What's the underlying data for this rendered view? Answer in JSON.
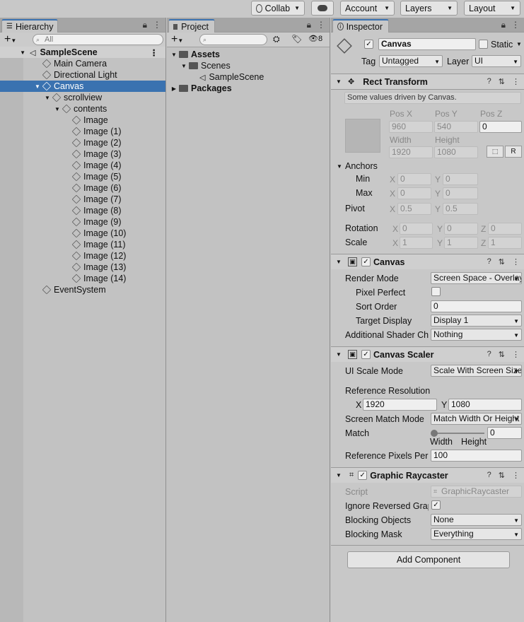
{
  "toolbar": {
    "collab": "Collab",
    "account": "Account",
    "layers": "Layers",
    "layout": "Layout"
  },
  "hierarchy": {
    "tab": "Hierarchy",
    "search_placeholder": "All",
    "scene": "SampleScene",
    "items": [
      {
        "label": "Main Camera",
        "depth": 1
      },
      {
        "label": "Directional Light",
        "depth": 1
      },
      {
        "label": "Canvas",
        "depth": 1,
        "selected": true,
        "expanded": true
      },
      {
        "label": "scrollview",
        "depth": 2,
        "expanded": true
      },
      {
        "label": "contents",
        "depth": 3,
        "expanded": true
      },
      {
        "label": "Image",
        "depth": 4
      },
      {
        "label": "Image (1)",
        "depth": 4
      },
      {
        "label": "Image (2)",
        "depth": 4
      },
      {
        "label": "Image (3)",
        "depth": 4
      },
      {
        "label": "Image (4)",
        "depth": 4
      },
      {
        "label": "Image (5)",
        "depth": 4
      },
      {
        "label": "Image (6)",
        "depth": 4
      },
      {
        "label": "Image (7)",
        "depth": 4
      },
      {
        "label": "Image (8)",
        "depth": 4
      },
      {
        "label": "Image (9)",
        "depth": 4
      },
      {
        "label": "Image (10)",
        "depth": 4
      },
      {
        "label": "Image (11)",
        "depth": 4
      },
      {
        "label": "Image (12)",
        "depth": 4
      },
      {
        "label": "Image (13)",
        "depth": 4
      },
      {
        "label": "Image (14)",
        "depth": 4
      },
      {
        "label": "EventSystem",
        "depth": 1
      }
    ]
  },
  "project": {
    "tab": "Project",
    "hidden_count": "8",
    "assets": "Assets",
    "scenes": "Scenes",
    "sample_scene": "SampleScene",
    "packages": "Packages"
  },
  "inspector": {
    "tab": "Inspector",
    "object_name": "Canvas",
    "static_label": "Static",
    "tag_label": "Tag",
    "tag_value": "Untagged",
    "layer_label": "Layer",
    "layer_value": "UI",
    "rect_transform": {
      "title": "Rect Transform",
      "note": "Some values driven by Canvas.",
      "pos_x_label": "Pos X",
      "pos_y_label": "Pos Y",
      "pos_z_label": "Pos Z",
      "pos_x": "960",
      "pos_y": "540",
      "pos_z": "0",
      "width_label": "Width",
      "height_label": "Height",
      "width": "1920",
      "height": "1080",
      "r_button": "R",
      "anchors_label": "Anchors",
      "min_label": "Min",
      "min_x": "0",
      "min_y": "0",
      "max_label": "Max",
      "max_x": "0",
      "max_y": "0",
      "pivot_label": "Pivot",
      "pivot_x": "0.5",
      "pivot_y": "0.5",
      "rotation_label": "Rotation",
      "rot_x": "0",
      "rot_y": "0",
      "rot_z": "0",
      "scale_label": "Scale",
      "scale_x": "1",
      "scale_y": "1",
      "scale_z": "1",
      "x": "X",
      "y": "Y",
      "z": "Z"
    },
    "canvas": {
      "title": "Canvas",
      "render_mode_label": "Render Mode",
      "render_mode": "Screen Space - Overlay",
      "pixel_perfect_label": "Pixel Perfect",
      "sort_order_label": "Sort Order",
      "sort_order": "0",
      "target_display_label": "Target Display",
      "target_display": "Display 1",
      "shader_channels_label": "Additional Shader Ch",
      "shader_channels": "Nothing"
    },
    "canvas_scaler": {
      "title": "Canvas Scaler",
      "ui_scale_mode_label": "UI Scale Mode",
      "ui_scale_mode": "Scale With Screen Size",
      "ref_res_label": "Reference Resolution",
      "ref_x": "1920",
      "ref_y": "1080",
      "screen_match_label": "Screen Match Mode",
      "screen_match": "Match Width Or Height",
      "match_label": "Match",
      "match_value": "0",
      "match_left": "Width",
      "match_right": "Height",
      "ref_pixels_label": "Reference Pixels Per",
      "ref_pixels": "100"
    },
    "raycaster": {
      "title": "Graphic Raycaster",
      "script_label": "Script",
      "script": "GraphicRaycaster",
      "ignore_label": "Ignore Reversed Grap",
      "blocking_objects_label": "Blocking Objects",
      "blocking_objects": "None",
      "blocking_mask_label": "Blocking Mask",
      "blocking_mask": "Everything"
    },
    "add_component": "Add Component"
  }
}
